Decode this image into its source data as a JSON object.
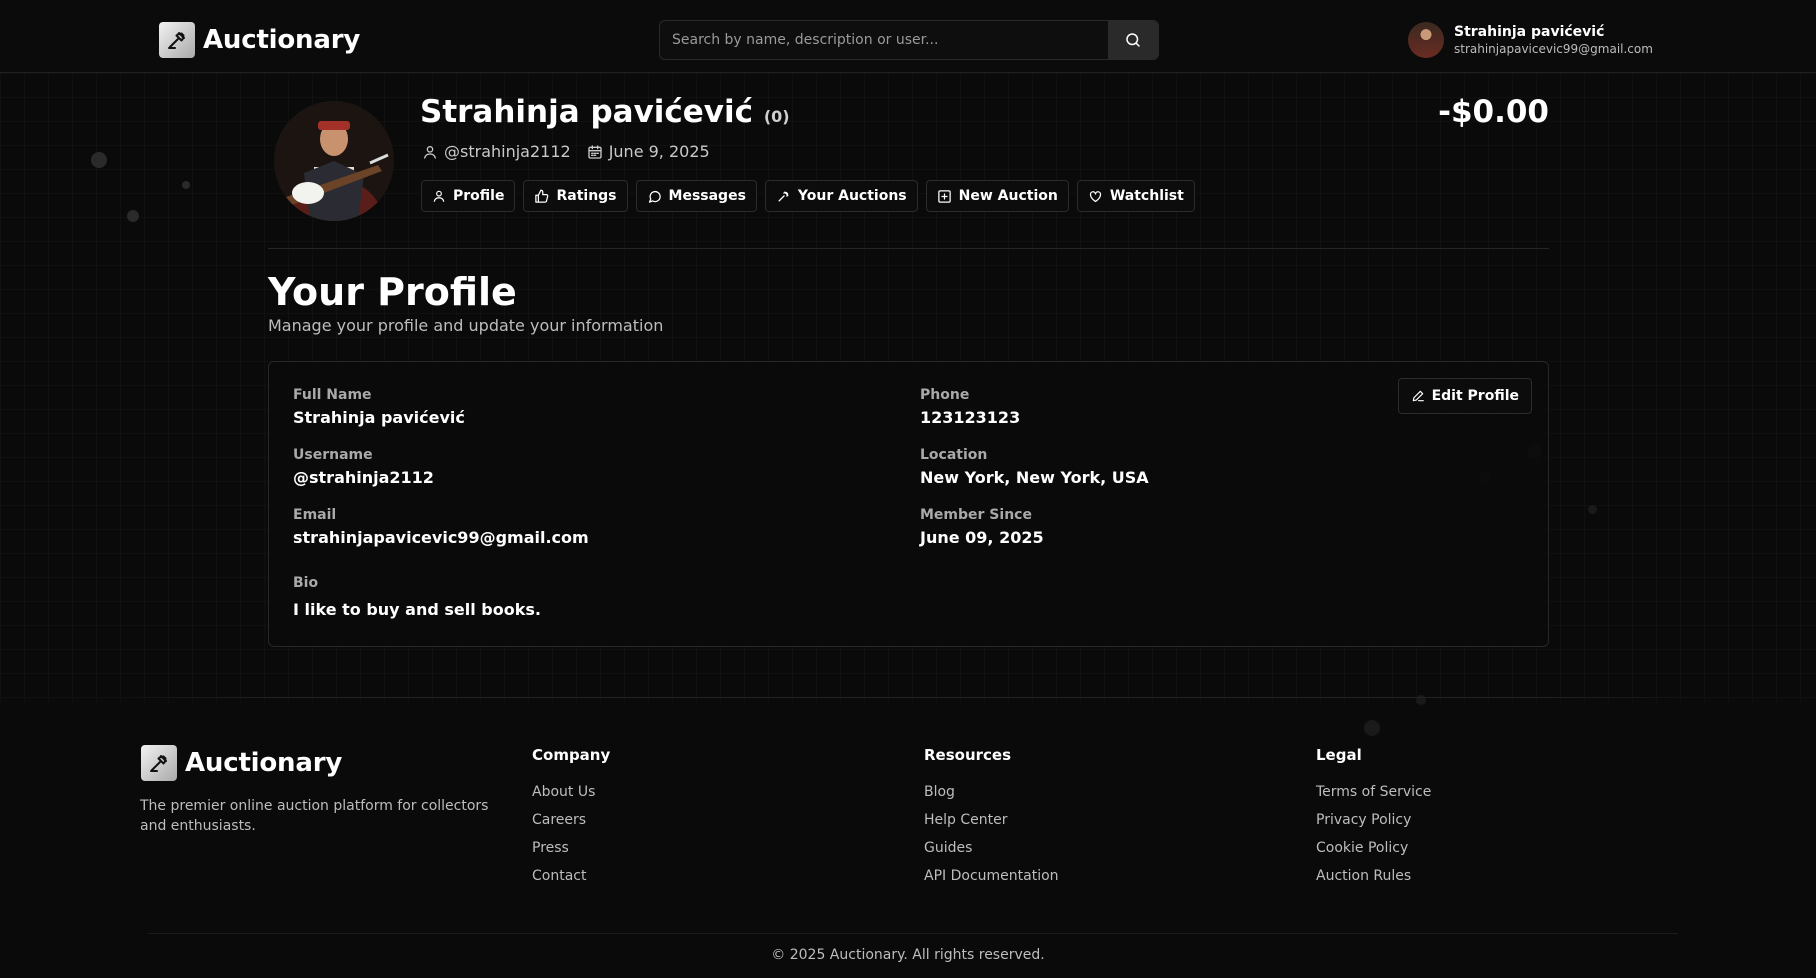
{
  "header": {
    "brand": "Auctionary",
    "search_placeholder": "Search by name, description or user...",
    "user_name": "Strahinja pavićević",
    "user_email": "strahinjapavicevic99@gmail.com"
  },
  "profile": {
    "name": "Strahinja pavićević",
    "rating_count": "(0)",
    "username": "@strahinja2112",
    "joined": "June 9, 2025",
    "balance": "-$0.00"
  },
  "nav_tabs": [
    {
      "label": "Profile",
      "icon": "user-icon"
    },
    {
      "label": "Ratings",
      "icon": "thumbs-up-icon"
    },
    {
      "label": "Messages",
      "icon": "message-icon"
    },
    {
      "label": "Your Auctions",
      "icon": "gavel-icon"
    },
    {
      "label": "New Auction",
      "icon": "plus-square-icon"
    },
    {
      "label": "Watchlist",
      "icon": "heart-icon"
    }
  ],
  "page": {
    "title": "Your Profile",
    "subtitle": "Manage your profile and update your information"
  },
  "details": {
    "edit_label": "Edit Profile",
    "full_name_label": "Full Name",
    "full_name": "Strahinja pavićević",
    "username_label": "Username",
    "username": "@strahinja2112",
    "email_label": "Email",
    "email": "strahinjapavicevic99@gmail.com",
    "bio_label": "Bio",
    "bio": "I like to buy and sell books.",
    "phone_label": "Phone",
    "phone": "123123123",
    "location_label": "Location",
    "location": "New York, New York, USA",
    "member_since_label": "Member Since",
    "member_since": "June 09, 2025"
  },
  "footer": {
    "brand": "Auctionary",
    "description": "The premier online auction platform for collectors and enthusiasts.",
    "columns": [
      {
        "title": "Company",
        "links": [
          "About Us",
          "Careers",
          "Press",
          "Contact"
        ]
      },
      {
        "title": "Resources",
        "links": [
          "Blog",
          "Help Center",
          "Guides",
          "API Documentation"
        ]
      },
      {
        "title": "Legal",
        "links": [
          "Terms of Service",
          "Privacy Policy",
          "Cookie Policy",
          "Auction Rules"
        ]
      }
    ],
    "copyright": "© 2025 Auctionary. All rights reserved."
  }
}
